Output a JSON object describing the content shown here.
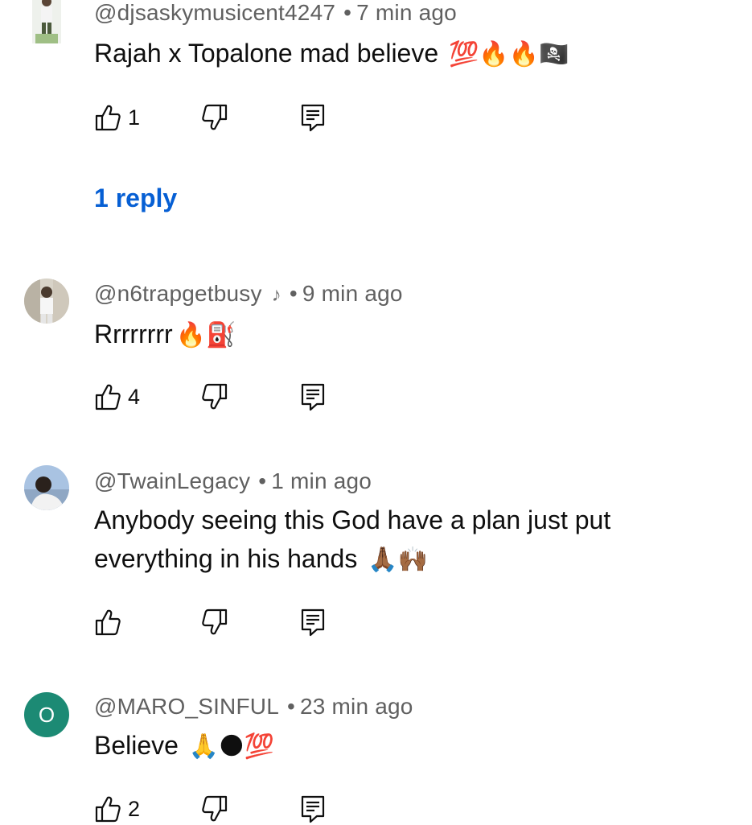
{
  "comments": [
    {
      "handle": "@djsaskymusicent4247",
      "time": "7 min ago",
      "text": "Rajah x Topalone mad believe",
      "emojis": "💯🔥🔥🏴‍☠️",
      "likes": "1",
      "replies_label": "1 reply",
      "avatar": "photo-avatar"
    },
    {
      "handle": "@n6trapgetbusy",
      "badge": "♪",
      "time": "9 min ago",
      "text": "Rrrrrrrr",
      "emojis": "🔥⛽",
      "likes": "4",
      "avatar": "photo-avatar"
    },
    {
      "handle": "@TwainLegacy",
      "time": "1 min ago",
      "text_line1": "Anybody seeing this God have a plan just put",
      "text_line2": "everything in his hands",
      "emojis": "🙏🏾🙌🏾",
      "likes": "",
      "avatar": "photo-avatar"
    },
    {
      "handle": "@MARO_SINFUL",
      "time": "23 min ago",
      "text": "Believe",
      "emojis": "🙏🌑💯",
      "likes": "2",
      "avatar_letter": "O",
      "avatar_color": "#1c8a74"
    }
  ],
  "separator": "•",
  "colors": {
    "meta": "#606060",
    "text": "#0f0f0f",
    "link": "#065fd4"
  },
  "icons": {
    "like": "thumbs-up-icon",
    "dislike": "thumbs-down-icon",
    "reply": "reply-comment-icon"
  }
}
